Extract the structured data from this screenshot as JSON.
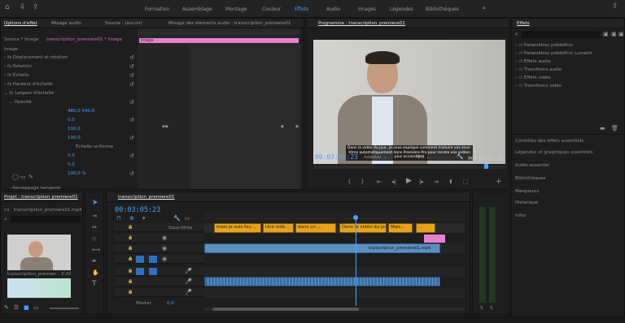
{
  "workspaces": [
    "Formation",
    "Assemblage",
    "Montage",
    "Couleur",
    "Effets",
    "Audio",
    "Images",
    "Légendes",
    "Bibliothèques"
  ],
  "active_workspace": "Effets",
  "effect_controls": {
    "tabs": [
      "Options d'effet",
      "Mixage audio",
      "Source : (aucun)",
      "Mixage des éléments audio : transcription_premiere01"
    ],
    "source_label": "Source * Image",
    "clip_label": "transcription_premiere01 * Image",
    "section": "Image",
    "rows": [
      "Déplacement et rotation",
      "Rotation",
      "Échelle",
      "Hauteur d'échelle",
      "Largeur d'échelle",
      "Opacité",
      "Remappage temporel"
    ],
    "values": [
      "480,0    540,0",
      "0,0",
      "100,0",
      "100,0",
      "Échelle uniforme",
      "0,0",
      "0,0",
      "100,0 %"
    ],
    "fx_clip": "Image"
  },
  "program": {
    "title": "Programme : transcription_premiere01",
    "subtitle_text": "Dans la vidéo du jour, je vous explique comment traduire vos sous-titres automatiquement dans Première Pro pour rendre vos vidéos plus accessibles",
    "timecode_left": "00:03:05:23",
    "fit": "Adapter",
    "ratio": "1/2",
    "timecode_right": "00:03:21:08"
  },
  "effects_panel": {
    "title": "Effets",
    "folders": [
      "Paramètres prédéfinis",
      "Paramètres prédéfinis Lumetri",
      "Effets audio",
      "Transitions audio",
      "Effets vidéo",
      "Transitions vidéo"
    ],
    "sections": [
      "Contrôles des effets essentiels",
      "Légendes et graphiques essentiels",
      "Audio essentiel",
      "Bibliothèques",
      "Marqueurs",
      "Historique",
      "Infos"
    ]
  },
  "project": {
    "title": "Projet : transcription_premiere01",
    "item_label": "transcription_premiere01.mp4",
    "clip_name": "transcription_premiere01",
    "duration": "3:20"
  },
  "timeline": {
    "title": "transcription_premiere01",
    "timecode": "00:03:05:23",
    "caption_track": "Sous-titres",
    "caption_clips": [
      "mais je suis fou ...",
      "Une vidé...",
      "dans un ...",
      "Dans la vidéo du jour...",
      "Mais...",
      "..."
    ],
    "video_clip": "transcription_premiere01.mp4",
    "master": "Master",
    "master_value": "0,0"
  },
  "meter_labels": [
    "S",
    "S"
  ]
}
